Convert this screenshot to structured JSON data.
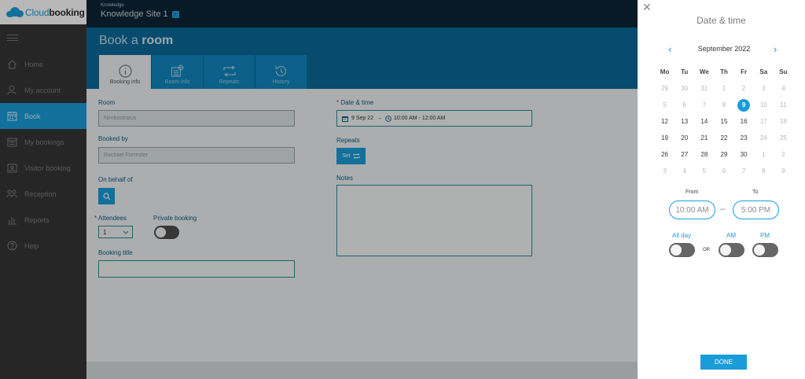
{
  "logo": {
    "prefix": "Cloud",
    "suffix": "booking"
  },
  "sidebar": {
    "items": [
      {
        "label": "Home",
        "icon": "home-icon"
      },
      {
        "label": "My account",
        "icon": "user-icon"
      },
      {
        "label": "Book",
        "icon": "calendar-icon",
        "active": true
      },
      {
        "label": "My bookings",
        "icon": "list-calendar-icon"
      },
      {
        "label": "Visitor booking",
        "icon": "visitor-icon"
      },
      {
        "label": "Reception",
        "icon": "reception-icon"
      },
      {
        "label": "Reports",
        "icon": "bar-chart-icon"
      },
      {
        "label": "Help",
        "icon": "help-icon"
      }
    ]
  },
  "topbar": {
    "context": "Knowledge",
    "site": "Knowledge Site 1"
  },
  "page": {
    "title_light": "Book a",
    "title_bold": "room"
  },
  "tabs": [
    {
      "label": "Booking info",
      "active": true
    },
    {
      "label": "Room info"
    },
    {
      "label": "Repeats"
    },
    {
      "label": "History"
    }
  ],
  "form": {
    "room_label": "Room",
    "room_value": "Nimbostratus",
    "booked_by_label": "Booked by",
    "booked_by_value": "Rachael Forrester",
    "on_behalf_label": "On behalf of",
    "attendees_label": "Attendees",
    "attendees_value": "1",
    "private_label": "Private booking",
    "title_label": "Booking title",
    "datetime_label": "Date & time",
    "datetime_date": "9 Sep 22",
    "datetime_time": "10:00 AM - 12:00 AM",
    "repeats_label": "Repeats",
    "set_label": "Set",
    "notes_label": "Notes"
  },
  "datepanel": {
    "title": "Date & time",
    "month": "September 2022",
    "weekdays": [
      "Mo",
      "Tu",
      "We",
      "Th",
      "Fr",
      "Sa",
      "Su"
    ],
    "weeks": [
      [
        [
          "29",
          1
        ],
        [
          "30",
          1
        ],
        [
          "31",
          1
        ],
        [
          "1",
          1
        ],
        [
          "2",
          1
        ],
        [
          "3",
          1
        ],
        [
          "4",
          1
        ]
      ],
      [
        [
          "5",
          1
        ],
        [
          "6",
          1
        ],
        [
          "7",
          1
        ],
        [
          "8",
          1
        ],
        [
          "9",
          2
        ],
        [
          "10",
          1
        ],
        [
          "11",
          1
        ]
      ],
      [
        [
          "12",
          0
        ],
        [
          "13",
          0
        ],
        [
          "14",
          0
        ],
        [
          "15",
          0
        ],
        [
          "16",
          0
        ],
        [
          "17",
          1
        ],
        [
          "18",
          1
        ]
      ],
      [
        [
          "19",
          0
        ],
        [
          "20",
          0
        ],
        [
          "21",
          0
        ],
        [
          "22",
          0
        ],
        [
          "23",
          0
        ],
        [
          "24",
          1
        ],
        [
          "25",
          1
        ]
      ],
      [
        [
          "26",
          0
        ],
        [
          "27",
          0
        ],
        [
          "28",
          0
        ],
        [
          "29",
          0
        ],
        [
          "30",
          0
        ],
        [
          "1",
          1
        ],
        [
          "2",
          1
        ]
      ],
      [
        [
          "3",
          1
        ],
        [
          "4",
          1
        ],
        [
          "5",
          1
        ],
        [
          "6",
          1
        ],
        [
          "7",
          1
        ],
        [
          "8",
          1
        ],
        [
          "9",
          1
        ]
      ]
    ],
    "from_label": "From",
    "to_label": "To",
    "from_value": "10:00 AM",
    "to_value": "5:00 PM",
    "dash": "–",
    "allday_label": "All day",
    "or_label": "OR",
    "am_label": "AM",
    "pm_label": "PM",
    "done_label": "DONE"
  },
  "colors": {
    "accent": "#1a9cd8",
    "sidebar": "#353535",
    "topbar": "#0d2537",
    "header": "#0a6a99"
  }
}
